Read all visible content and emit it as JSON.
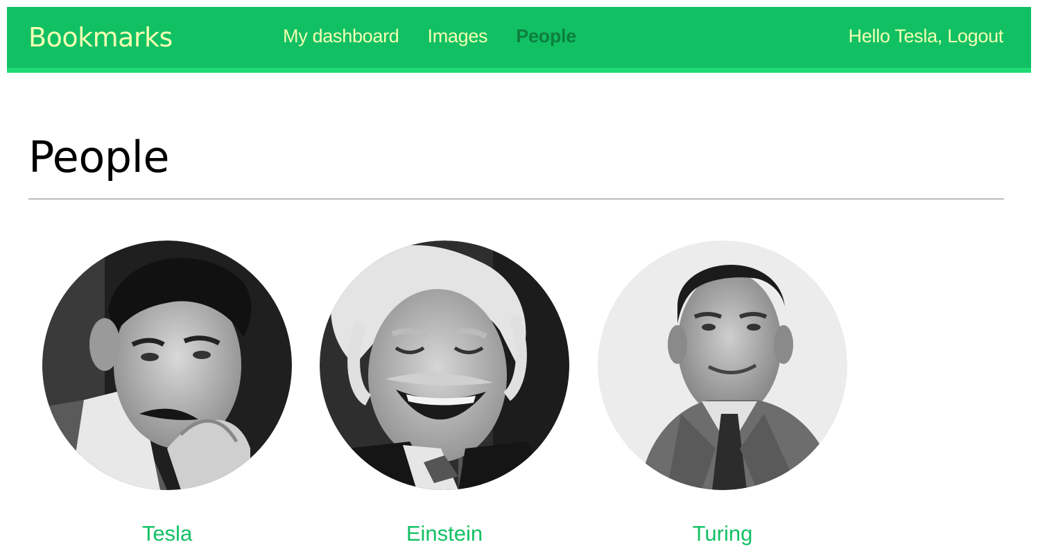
{
  "header": {
    "logo": "Bookmarks",
    "menu": [
      {
        "label": "My dashboard",
        "selected": false
      },
      {
        "label": "Images",
        "selected": false
      },
      {
        "label": "People",
        "selected": true
      }
    ],
    "greeting": "Hello Tesla,",
    "logout": "Logout"
  },
  "main": {
    "title": "People",
    "people": [
      {
        "name": "Tesla",
        "photo": "tesla-portrait"
      },
      {
        "name": "Einstein",
        "photo": "einstein-portrait"
      },
      {
        "name": "Turing",
        "photo": "turing-portrait"
      }
    ]
  },
  "colors": {
    "header_bg": "#12c064",
    "header_border": "#1fdb75",
    "menu_text": "#f2ffb2",
    "menu_selected": "#0c7f3f",
    "link": "#12c064"
  }
}
